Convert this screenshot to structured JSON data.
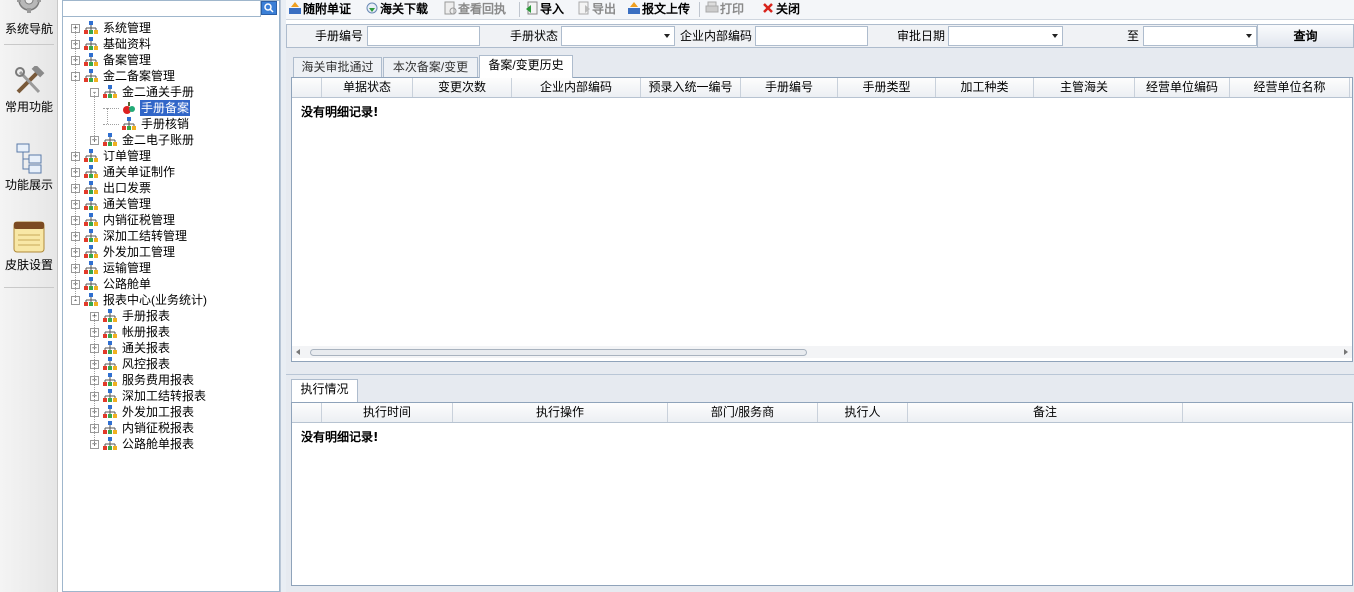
{
  "rail": {
    "items": [
      {
        "label": "系统导航",
        "icon": "gear-icon"
      },
      {
        "label": "常用功能",
        "icon": "tools-icon"
      },
      {
        "label": "功能展示",
        "icon": "flowchart-icon"
      },
      {
        "label": "皮肤设置",
        "icon": "notepad-icon"
      }
    ]
  },
  "tree": {
    "search_placeholder": "",
    "nodes": [
      {
        "label": "系统管理",
        "level": 0,
        "expander": "+"
      },
      {
        "label": "基础资料",
        "level": 0,
        "expander": "+"
      },
      {
        "label": "备案管理",
        "level": 0,
        "expander": "+"
      },
      {
        "label": "金二备案管理",
        "level": 0,
        "expander": "-"
      },
      {
        "label": "金二通关手册",
        "level": 1,
        "expander": "-"
      },
      {
        "label": "手册备案",
        "level": 2,
        "expander": "",
        "selected": true
      },
      {
        "label": "手册核销",
        "level": 2,
        "expander": ""
      },
      {
        "label": "金二电子账册",
        "level": 1,
        "expander": "+"
      },
      {
        "label": "订单管理",
        "level": 0,
        "expander": "+"
      },
      {
        "label": "通关单证制作",
        "level": 0,
        "expander": "+"
      },
      {
        "label": "出口发票",
        "level": 0,
        "expander": "+"
      },
      {
        "label": "通关管理",
        "level": 0,
        "expander": "+"
      },
      {
        "label": "内销征税管理",
        "level": 0,
        "expander": "+"
      },
      {
        "label": "深加工结转管理",
        "level": 0,
        "expander": "+"
      },
      {
        "label": "外发加工管理",
        "level": 0,
        "expander": "+"
      },
      {
        "label": "运输管理",
        "level": 0,
        "expander": "+"
      },
      {
        "label": "公路舱单",
        "level": 0,
        "expander": "+"
      },
      {
        "label": "报表中心(业务统计)",
        "level": 0,
        "expander": "-"
      },
      {
        "label": "手册报表",
        "level": 1,
        "expander": "+"
      },
      {
        "label": "帐册报表",
        "level": 1,
        "expander": "+"
      },
      {
        "label": "通关报表",
        "level": 1,
        "expander": "+"
      },
      {
        "label": "风控报表",
        "level": 1,
        "expander": "+"
      },
      {
        "label": "服务费用报表",
        "level": 1,
        "expander": "+"
      },
      {
        "label": "深加工结转报表",
        "level": 1,
        "expander": "+"
      },
      {
        "label": "外发加工报表",
        "level": 1,
        "expander": "+"
      },
      {
        "label": "内销征税报表",
        "level": 1,
        "expander": "+"
      },
      {
        "label": "公路舱单报表",
        "level": 1,
        "expander": "+"
      }
    ]
  },
  "toolbar": {
    "buttons": [
      {
        "label": "随附单证",
        "icon": "upload-doc-icon",
        "enabled": true
      },
      {
        "label": "海关下载",
        "icon": "download-icon",
        "enabled": true
      },
      {
        "label": "查看回执",
        "icon": "receipt-icon",
        "enabled": false
      },
      {
        "label": "导入",
        "icon": "import-icon",
        "enabled": true
      },
      {
        "label": "导出",
        "icon": "export-icon",
        "enabled": false
      },
      {
        "label": "报文上传",
        "icon": "upload-icon",
        "enabled": true
      },
      {
        "label": "打印",
        "icon": "printer-icon",
        "enabled": false
      },
      {
        "label": "关闭",
        "icon": "close-icon",
        "enabled": true
      }
    ]
  },
  "filter": {
    "manual_no_label": "手册编号",
    "manual_no_value": "",
    "manual_status_label": "手册状态",
    "manual_status_value": "",
    "internal_code_label": "企业内部编码",
    "internal_code_value": "",
    "approve_date_label": "审批日期",
    "approve_date_from": "",
    "to_label": "至",
    "approve_date_to": "",
    "query_label": "查询"
  },
  "top_tabs": [
    {
      "label": "海关审批通过",
      "active": false
    },
    {
      "label": "本次备案/变更",
      "active": false
    },
    {
      "label": "备案/变更历史",
      "active": true
    }
  ],
  "main_grid": {
    "columns": [
      "单据状态",
      "变更次数",
      "企业内部编码",
      "预录入统一编号",
      "手册编号",
      "手册类型",
      "加工种类",
      "主管海关",
      "经营单位编码",
      "经营单位名称"
    ],
    "empty_text": "没有明细记录!"
  },
  "bottom_tabs": [
    {
      "label": "执行情况",
      "active": true
    }
  ],
  "exec_grid": {
    "columns": [
      "执行时间",
      "执行操作",
      "部门/服务商",
      "执行人",
      "备注"
    ],
    "empty_text": "没有明细记录!"
  },
  "colors": {
    "selection": "#3166c8",
    "border": "#8fa3ba",
    "close_red": "#d8241c"
  }
}
